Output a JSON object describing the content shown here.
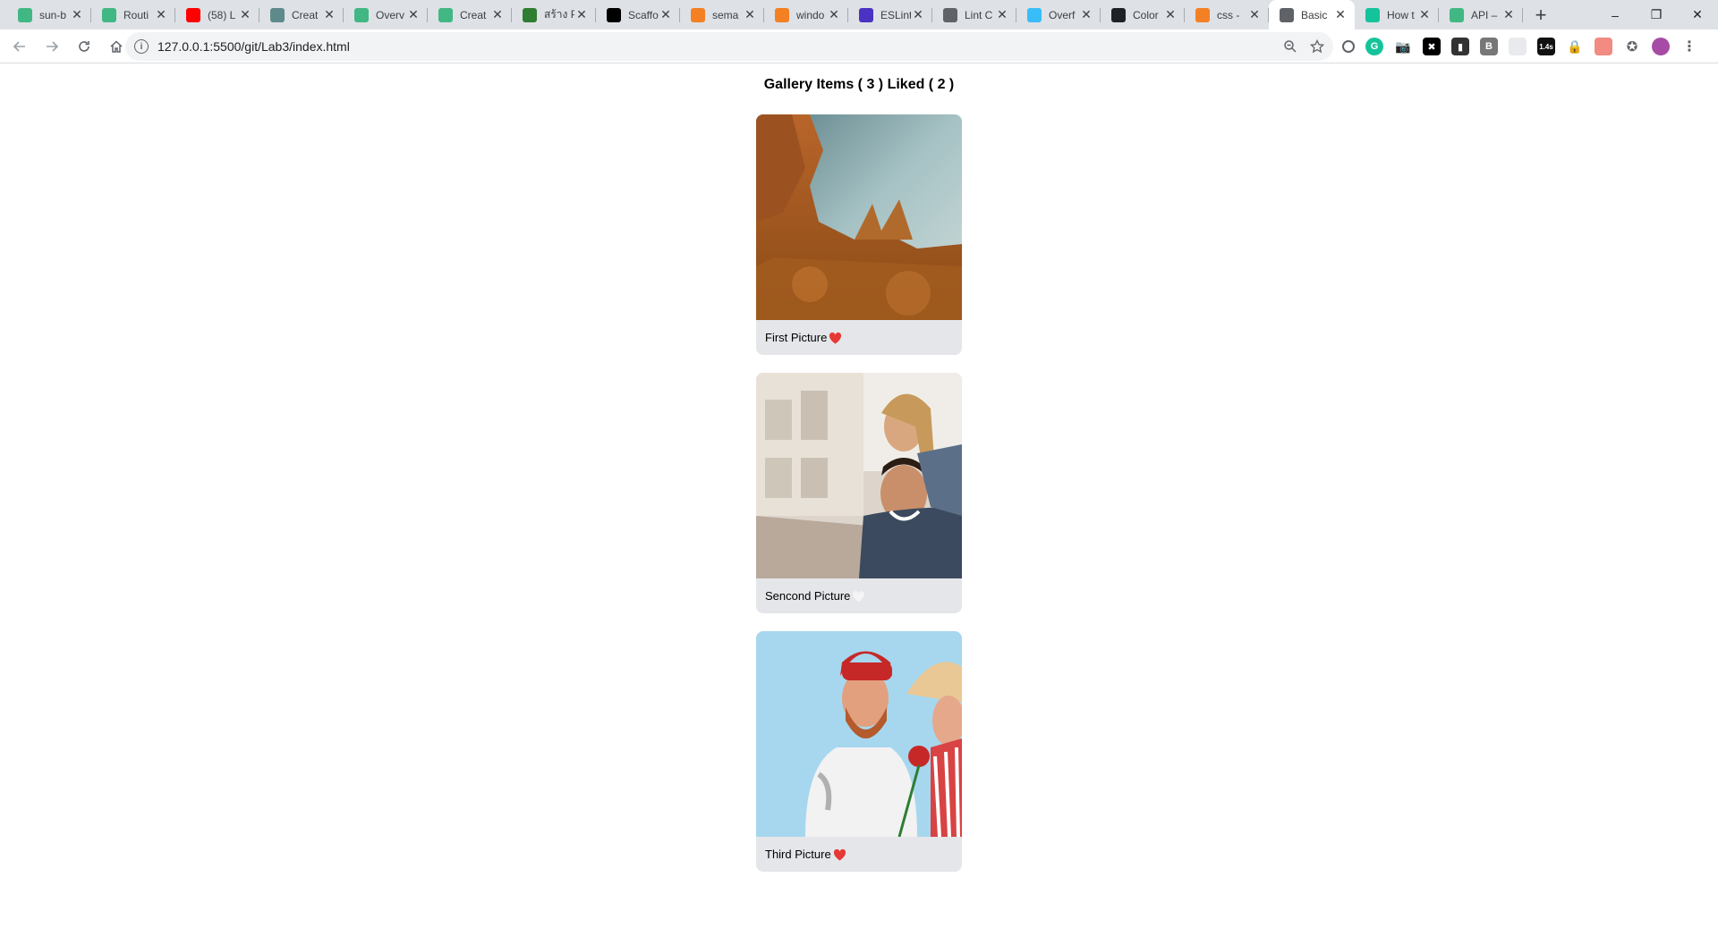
{
  "browser": {
    "tabs": [
      {
        "title": "sun-b",
        "icon": "vue-icon",
        "color": "#41b883"
      },
      {
        "title": "Routi",
        "icon": "vue-icon",
        "color": "#41b883"
      },
      {
        "title": "(58) L",
        "icon": "youtube-icon",
        "color": "#ff0000"
      },
      {
        "title": "Creat",
        "icon": "globe-icon",
        "color": "#5f8a8b"
      },
      {
        "title": "Overv",
        "icon": "vue-icon",
        "color": "#41b883"
      },
      {
        "title": "Creat",
        "icon": "vue-icon",
        "color": "#41b883"
      },
      {
        "title": "สร้าง P",
        "icon": "pen-icon",
        "color": "#2e7d32"
      },
      {
        "title": "Scaffo",
        "icon": "wikipedia-icon",
        "color": "#000000"
      },
      {
        "title": "sema",
        "icon": "stackoverflow-icon",
        "color": "#f48024"
      },
      {
        "title": "windo",
        "icon": "stackoverflow-icon",
        "color": "#f48024"
      },
      {
        "title": "ESLint",
        "icon": "eslint-icon",
        "color": "#4b32c3"
      },
      {
        "title": "Lint C",
        "icon": "circle-icon",
        "color": "#5f6368"
      },
      {
        "title": "Overf",
        "icon": "tailwind-icon",
        "color": "#38bdf8"
      },
      {
        "title": "Color",
        "icon": "github-icon",
        "color": "#202124"
      },
      {
        "title": "css - ",
        "icon": "stackoverflow-icon",
        "color": "#f48024"
      },
      {
        "title": "Basic",
        "icon": "globe-icon",
        "color": "#5f6368",
        "active": true
      },
      {
        "title": "How t",
        "icon": "grammarly-icon",
        "color": "#15c39a"
      },
      {
        "title": "API –",
        "icon": "vue-icon",
        "color": "#41b883"
      }
    ],
    "url": "127.0.0.1:5500/git/Lab3/index.html",
    "extension_badge": "1.4s"
  },
  "page": {
    "title": "Gallery Items ( 3 ) Liked ( 2 )",
    "items": [
      {
        "caption": "First Picture",
        "liked": true
      },
      {
        "caption": "Sencond Picture",
        "liked": false
      },
      {
        "caption": "Third Picture",
        "liked": true
      }
    ]
  },
  "colors": {
    "heart_liked": "#e53935",
    "heart_unliked": "#ffffff",
    "card_bg": "#e5e6ea"
  }
}
